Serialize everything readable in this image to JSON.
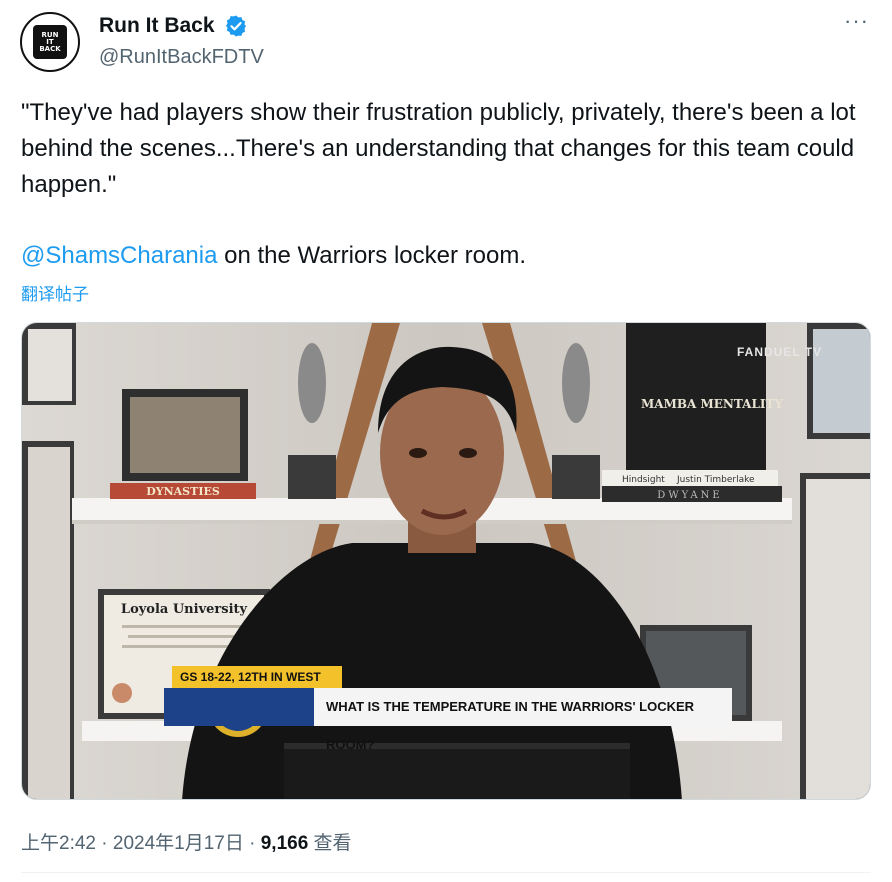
{
  "author": {
    "display_name": "Run It Back",
    "handle": "@RunItBackFDTV",
    "avatar_text": [
      "RUN",
      "IT",
      "BACK"
    ],
    "verified_icon": "verified-badge-icon"
  },
  "menu": {
    "more_label": "···"
  },
  "tweet": {
    "text": "\"They've had players show their frustration publicly, privately, there's been a lot behind the scenes...There's an understanding that changes for this team could happen.\"",
    "mention": "@ShamsCharania",
    "mention_suffix": " on the Warriors locker room.",
    "translate_label": "翻译帖子"
  },
  "media": {
    "lower_third_tag": "GS 18-22, 12TH IN WEST",
    "lower_third_headline": "WHAT IS THE TEMPERATURE IN THE WARRIORS' LOCKER ROOM?",
    "watermark": "FANDUEL TV",
    "book_dynasties": "DYNASTIES",
    "book_mamba": "MAMBA MENTALITY",
    "book_hindsight": "Hindsight",
    "book_justin": "Justin Timberlake",
    "book_dwyane": "DWYANE",
    "diploma_title": "Loyola University"
  },
  "footer": {
    "time": "上午2:42",
    "sep1": " · ",
    "date": "2024年1月17日",
    "sep2": " · ",
    "views": "9,166",
    "views_label": " 查看"
  },
  "colors": {
    "link": "#1d9bf0",
    "secondary": "#536471",
    "primary": "#0f1419",
    "warriors_blue": "#1d428a",
    "warriors_gold": "#f3c22b"
  }
}
